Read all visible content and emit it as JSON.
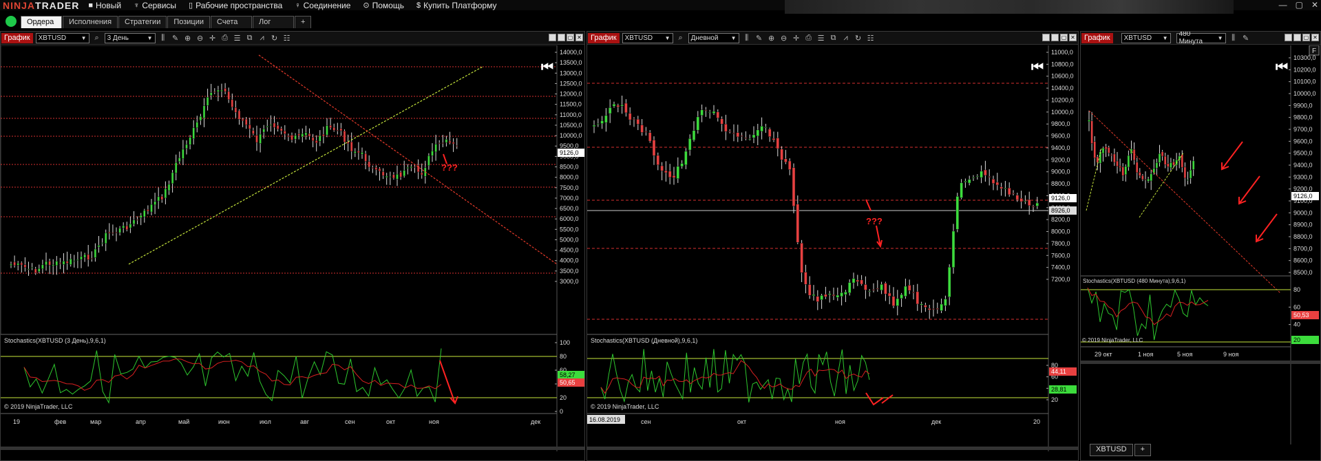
{
  "app": {
    "logo_a": "NINJA",
    "logo_b": "TRADER"
  },
  "menu": [
    {
      "name": "new",
      "label": "Новый",
      "icon": "■"
    },
    {
      "name": "services",
      "label": "Сервисы",
      "icon": "♆"
    },
    {
      "name": "workspaces",
      "label": "Рабочие пространства",
      "icon": "▯"
    },
    {
      "name": "connection",
      "label": "Соединение",
      "icon": "♀"
    },
    {
      "name": "help",
      "label": "Помощь",
      "icon": "⊙"
    },
    {
      "name": "buy",
      "label": "Купить Платформу",
      "icon": "$"
    }
  ],
  "tabs": [
    "Ордера",
    "Исполнения",
    "Стратегии",
    "Позиции",
    "Счета",
    "Лог",
    "+"
  ],
  "chart1": {
    "label": "График",
    "instrument": "XBTUSD",
    "period": "3 День",
    "yticks": [
      "14000,0",
      "13500,0",
      "13000,0",
      "12500,0",
      "12000,0",
      "11500,0",
      "11000,0",
      "10500,0",
      "10000,0",
      "9500,0",
      "9000,0",
      "8500,0",
      "8000,0",
      "7500,0",
      "7000,0",
      "6500,0",
      "6000,0",
      "5500,0",
      "5000,0",
      "4500,0",
      "4000,0",
      "3500,0",
      "3000,0"
    ],
    "price_tag": "9126,0",
    "question": "???",
    "osc_title": "Stochastics(XBTUSD (3 День),9,6,1)",
    "osc_ticks": [
      "100",
      "80",
      "60",
      "40",
      "20",
      "0"
    ],
    "osc_vals": [
      "58,27",
      "50,65"
    ],
    "copyright": "© 2019 NinjaTrader, LLC",
    "xticks": [
      "19",
      "фев",
      "мар",
      "апр",
      "май",
      "июн",
      "июл",
      "авг",
      "сен",
      "окт",
      "ноя",
      "дек"
    ]
  },
  "chart2": {
    "label": "График",
    "instrument": "XBTUSD",
    "period": "Дневной",
    "yticks": [
      "11000,0",
      "10800,0",
      "10600,0",
      "10400,0",
      "10200,0",
      "10000,0",
      "9800,0",
      "9600,0",
      "9400,0",
      "9200,0",
      "9000,0",
      "8800,0",
      "8600,0",
      "8400,0",
      "8200,0",
      "8000,0",
      "7800,0",
      "7600,0",
      "7400,0",
      "7200,0"
    ],
    "price_tags": [
      "9126,0",
      "8926,0"
    ],
    "question": "???",
    "osc_title": "Stochastics(XBTUSD (Дневной),9,6,1)",
    "osc_ticks": [
      "80",
      "60",
      "40",
      "20"
    ],
    "osc_vals": [
      "44,11",
      "28,81"
    ],
    "copyright": "© 2019 NinjaTrader, LLC",
    "date_box": "16.08.2019",
    "xticks": [
      "сен",
      "окт",
      "ноя",
      "дек",
      "20"
    ]
  },
  "chart3": {
    "label": "График",
    "instrument": "XBTUSD",
    "period": "480 Минута",
    "yticks": [
      "10300,0",
      "10200,0",
      "10100,0",
      "10000,0",
      "9900,0",
      "9800,0",
      "9700,0",
      "9600,0",
      "9500,0",
      "9400,0",
      "9300,0",
      "9200,0",
      "9100,0",
      "9000,0",
      "8900,0",
      "8800,0",
      "8700,0",
      "8600,0",
      "8500,0"
    ],
    "price_tag": "9126,0",
    "f_label": "F",
    "osc_title": "Stochastics(XBTUSD (480 Минута),9,6,1)",
    "osc_ticks": [
      "80",
      "60",
      "40",
      "20"
    ],
    "osc_vals": [
      "50,53",
      "20"
    ],
    "copyright": "© 2019 NinjaTrader, LLC",
    "xticks": [
      "29 окт",
      "1 ноя",
      "5 ноя",
      "9 ноя"
    ],
    "bottom_tabs": [
      "XBTUSD",
      "+"
    ]
  },
  "colors": {
    "bull": "#3cdc3c",
    "bear": "#e84040",
    "level": "#d83030",
    "trend_up": "#c8e83c",
    "trend_down": "#e83a2a",
    "stoch_k": "#2ec82e",
    "stoch_d": "#d82020"
  }
}
